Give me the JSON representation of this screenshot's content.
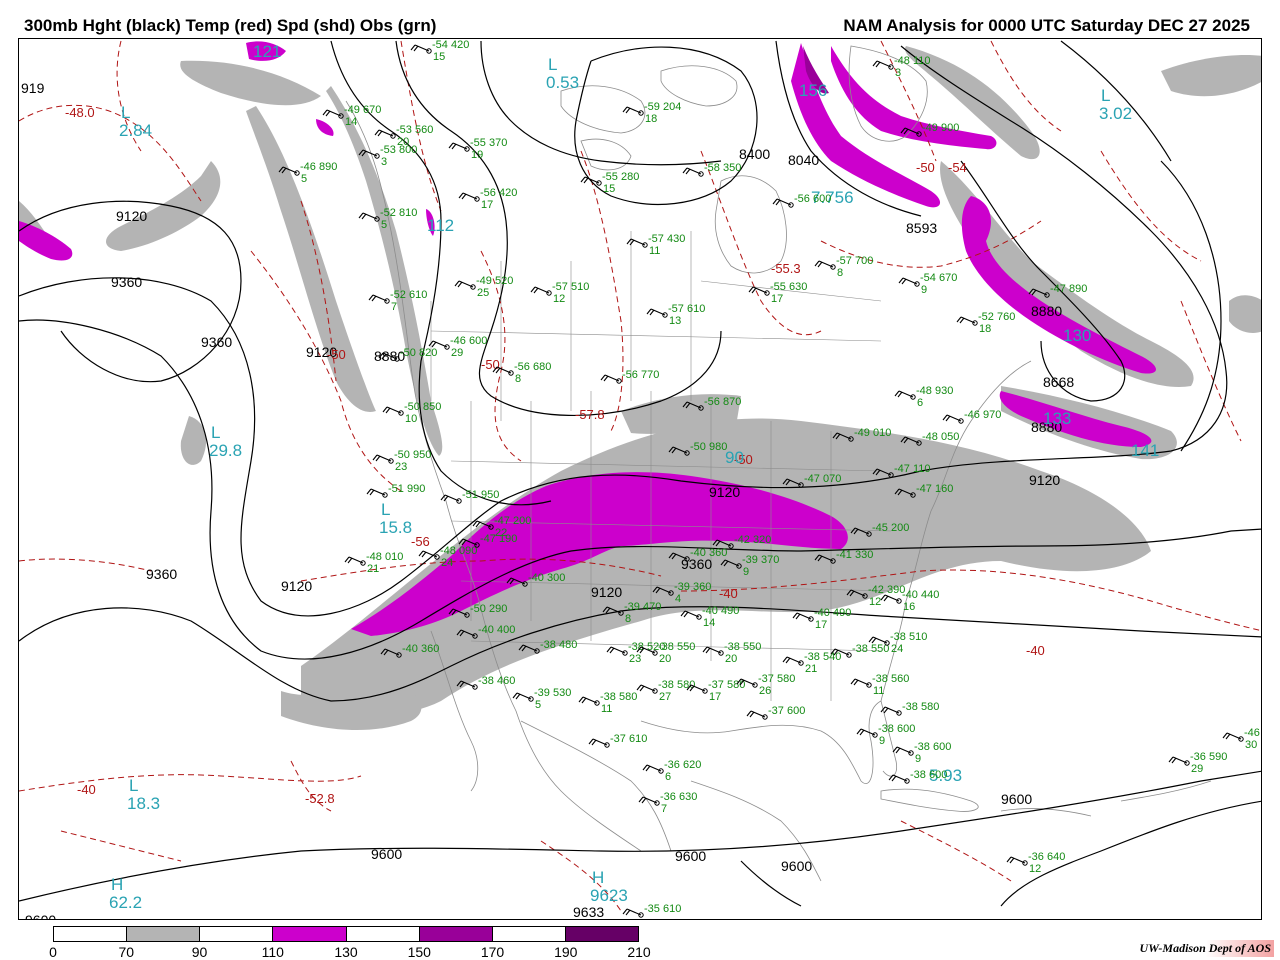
{
  "header": {
    "title": "300mb Hght (black) Temp (red) Spd (shd) Obs (grn)",
    "valid": "NAM Analysis for 0000 UTC Saturday  DEC 27 2025"
  },
  "colors": {
    "height_contour": "#000000",
    "temp_contour": "#b01515",
    "obs": "#138a13",
    "center_label": "#2aa3b3",
    "geography": "#8c8c8c"
  },
  "legend": {
    "ticks": [
      "0",
      "70",
      "90",
      "110",
      "130",
      "150",
      "170",
      "190",
      "210"
    ],
    "bins": [
      {
        "min": 0,
        "max": 70,
        "color": "#ffffff"
      },
      {
        "min": 70,
        "max": 90,
        "color": "#b4b4b4"
      },
      {
        "min": 90,
        "max": 110,
        "color": "#ffffff"
      },
      {
        "min": 110,
        "max": 130,
        "color": "#cc00cc"
      },
      {
        "min": 130,
        "max": 150,
        "color": "#ffffff"
      },
      {
        "min": 150,
        "max": 170,
        "color": "#990099"
      },
      {
        "min": 170,
        "max": 190,
        "color": "#ffffff"
      },
      {
        "min": 190,
        "max": 210,
        "color": "#660066"
      }
    ]
  },
  "credit": "UW-Madison  Dept of AOS",
  "height_labels": [
    "9120",
    "9360",
    "9360",
    "9120",
    "9120",
    "8880",
    "9360",
    "9120",
    "8400",
    "8040",
    "8593",
    "8880",
    "8668",
    "8880",
    "9120",
    "9120",
    "9360",
    "9600",
    "9600",
    "9600",
    "9600",
    "9633",
    "9600",
    "919"
  ],
  "temp_labels": [
    "-48.0",
    "-50",
    "-50",
    "-57.8",
    "-50",
    "-55.3",
    "-50",
    "-56",
    "-40",
    "-40",
    "-40",
    "-52.8",
    "-54"
  ],
  "centers": [
    {
      "symbol": "L",
      "value": "2.84"
    },
    {
      "symbol": "L",
      "value": "0.53"
    },
    {
      "symbol": "L",
      "value": "3.02"
    },
    {
      "symbol": "L",
      "value": "29.8"
    },
    {
      "symbol": "L",
      "value": "15.8"
    },
    {
      "symbol": "L",
      "value": "18.3"
    },
    {
      "symbol": "H",
      "value": "62.2"
    },
    {
      "symbol": "H",
      "value": "9623"
    },
    {
      "symbol": "",
      "value": "121"
    },
    {
      "symbol": "",
      "value": "112"
    },
    {
      "symbol": "",
      "value": "156"
    },
    {
      "symbol": "",
      "value": "7.756"
    },
    {
      "symbol": "",
      "value": "130"
    },
    {
      "symbol": "",
      "value": "141"
    },
    {
      "symbol": "",
      "value": "5.93"
    },
    {
      "symbol": "",
      "value": "133"
    },
    {
      "symbol": "",
      "value": "90"
    }
  ],
  "obs": [
    {
      "t": "-54",
      "h": "420",
      "d": "15"
    },
    {
      "t": "-53",
      "h": "560",
      "d": "20"
    },
    {
      "t": "-55",
      "h": "370",
      "d": "19"
    },
    {
      "t": "-53",
      "h": "800",
      "d": "3"
    },
    {
      "t": "-49",
      "h": "670",
      "d": "14"
    },
    {
      "t": "-46",
      "h": "890",
      "d": "5"
    },
    {
      "t": "-56",
      "h": "420",
      "d": "17"
    },
    {
      "t": "-52",
      "h": "810",
      "d": "5"
    },
    {
      "t": "-49",
      "h": "520",
      "d": "25"
    },
    {
      "t": "-52",
      "h": "610",
      "d": "7"
    },
    {
      "t": "-46",
      "h": "600",
      "d": "29"
    },
    {
      "t": "-56",
      "h": "680",
      "d": "8"
    },
    {
      "t": "-56",
      "h": "770",
      "d": ""
    },
    {
      "t": "-57",
      "h": "510",
      "d": "12"
    },
    {
      "t": "-57",
      "h": "610",
      "d": "13"
    },
    {
      "t": "-55",
      "h": "280",
      "d": "15"
    },
    {
      "t": "-59",
      "h": "204",
      "d": "18"
    },
    {
      "t": "-58",
      "h": "350",
      "d": ""
    },
    {
      "t": "-57",
      "h": "430",
      "d": "11"
    },
    {
      "t": "-56",
      "h": "600",
      "d": ""
    },
    {
      "t": "-57",
      "h": "700",
      "d": "8"
    },
    {
      "t": "-55",
      "h": "630",
      "d": "17"
    },
    {
      "t": "-54",
      "h": "670",
      "d": "9"
    },
    {
      "t": "-48",
      "h": "110",
      "d": "3"
    },
    {
      "t": "-49",
      "h": "900",
      "d": ""
    },
    {
      "t": "-52",
      "h": "760",
      "d": "18"
    },
    {
      "t": "-47",
      "h": "890",
      "d": ""
    },
    {
      "t": "-48",
      "h": "930",
      "d": "6"
    },
    {
      "t": "-46",
      "h": "970",
      "d": ""
    },
    {
      "t": "-49",
      "h": "010",
      "d": ""
    },
    {
      "t": "-50",
      "h": "980",
      "d": ""
    },
    {
      "t": "-50",
      "h": "950",
      "d": "23"
    },
    {
      "t": "-51",
      "h": "990",
      "d": ""
    },
    {
      "t": "-51",
      "h": "950",
      "d": ""
    },
    {
      "t": "-56",
      "h": "870",
      "d": ""
    },
    {
      "t": "-47",
      "h": "110",
      "d": ""
    },
    {
      "t": "-47",
      "h": "160",
      "d": ""
    },
    {
      "t": "-47",
      "h": "070",
      "d": ""
    },
    {
      "t": "-45",
      "h": "200",
      "d": ""
    },
    {
      "t": "-42",
      "h": "320",
      "d": ""
    },
    {
      "t": "-40",
      "h": "360",
      "d": ""
    },
    {
      "t": "-40",
      "h": "300",
      "d": ""
    },
    {
      "t": "-39",
      "h": "370",
      "d": "9"
    },
    {
      "t": "-41",
      "h": "330",
      "d": ""
    },
    {
      "t": "-42",
      "h": "390",
      "d": "12"
    },
    {
      "t": "-40",
      "h": "440",
      "d": "16"
    },
    {
      "t": "-39",
      "h": "360",
      "d": "4"
    },
    {
      "t": "-39",
      "h": "470",
      "d": "8"
    },
    {
      "t": "-40",
      "h": "490",
      "d": "14"
    },
    {
      "t": "-40",
      "h": "490",
      "d": "17"
    },
    {
      "t": "-40",
      "h": "400",
      "d": ""
    },
    {
      "t": "-40",
      "h": "360",
      "d": ""
    },
    {
      "t": "-38",
      "h": "460",
      "d": ""
    },
    {
      "t": "-38",
      "h": "480",
      "d": ""
    },
    {
      "t": "-38",
      "h": "520",
      "d": "23"
    },
    {
      "t": "-38",
      "h": "550",
      "d": "20"
    },
    {
      "t": "-38",
      "h": "550",
      "d": "20"
    },
    {
      "t": "-38",
      "h": "540",
      "d": "21"
    },
    {
      "t": "-38",
      "h": "550",
      "d": ""
    },
    {
      "t": "-38",
      "h": "510",
      "d": "24"
    },
    {
      "t": "-39",
      "h": "530",
      "d": "5"
    },
    {
      "t": "-38",
      "h": "580",
      "d": "11"
    },
    {
      "t": "-38",
      "h": "580",
      "d": "27"
    },
    {
      "t": "-37",
      "h": "580",
      "d": "17"
    },
    {
      "t": "-37",
      "h": "580",
      "d": "26"
    },
    {
      "t": "-38",
      "h": "560",
      "d": "11"
    },
    {
      "t": "-38",
      "h": "580",
      "d": ""
    },
    {
      "t": "-38",
      "h": "600",
      "d": "9"
    },
    {
      "t": "-38",
      "h": "600",
      "d": "9"
    },
    {
      "t": "-38",
      "h": "600",
      "d": ""
    },
    {
      "t": "-37",
      "h": "600",
      "d": ""
    },
    {
      "t": "-37",
      "h": "610",
      "d": ""
    },
    {
      "t": "-36",
      "h": "620",
      "d": "6"
    },
    {
      "t": "-36",
      "h": "630",
      "d": "7"
    },
    {
      "t": "-36",
      "h": "590",
      "d": "29"
    },
    {
      "t": "-36",
      "h": "640",
      "d": "12"
    },
    {
      "t": "-35",
      "h": "610",
      "d": ""
    },
    {
      "t": "-48",
      "h": "010",
      "d": "21"
    },
    {
      "t": "-48",
      "h": "090",
      "d": "24"
    },
    {
      "t": "-47",
      "h": "200",
      "d": "22"
    },
    {
      "t": "-50",
      "h": "290",
      "d": ""
    },
    {
      "t": "-47",
      "h": "190",
      "d": ""
    },
    {
      "t": "-50",
      "h": "850",
      "d": "10"
    },
    {
      "t": "-50",
      "h": "820",
      "d": ""
    },
    {
      "t": "-46",
      "h": "030",
      "d": "30"
    },
    {
      "t": "-48",
      "h": "050",
      "d": ""
    }
  ]
}
